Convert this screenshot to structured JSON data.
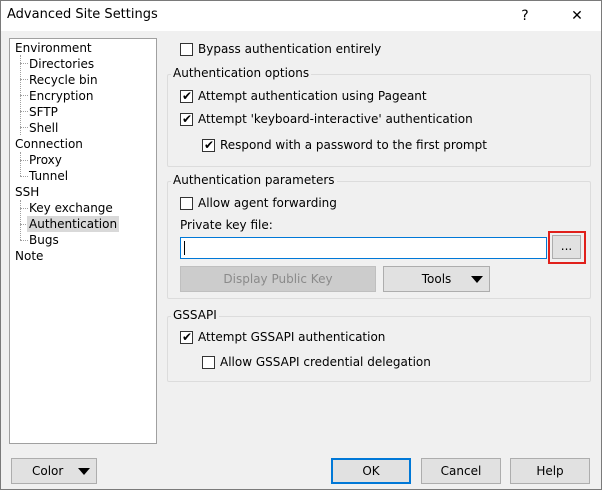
{
  "window": {
    "title": "Advanced Site Settings",
    "help_glyph": "?",
    "close_glyph": "✕"
  },
  "tree": {
    "items": [
      {
        "label": "Environment"
      },
      {
        "label": "Directories"
      },
      {
        "label": "Recycle bin"
      },
      {
        "label": "Encryption"
      },
      {
        "label": "SFTP"
      },
      {
        "label": "Shell"
      },
      {
        "label": "Connection"
      },
      {
        "label": "Proxy"
      },
      {
        "label": "Tunnel"
      },
      {
        "label": "SSH"
      },
      {
        "label": "Key exchange"
      },
      {
        "label": "Authentication"
      },
      {
        "label": "Bugs"
      },
      {
        "label": "Note"
      }
    ],
    "selected": "Authentication"
  },
  "bypass": {
    "label": "Bypass authentication entirely",
    "checked": false
  },
  "auth_options": {
    "title": "Authentication options",
    "pageant": {
      "label": "Attempt authentication using Pageant",
      "checked": true
    },
    "keyboard": {
      "label": "Attempt 'keyboard-interactive' authentication",
      "checked": true
    },
    "respond": {
      "label": "Respond with a password to the first prompt",
      "checked": true
    }
  },
  "auth_params": {
    "title": "Authentication parameters",
    "agent_forwarding": {
      "label": "Allow agent forwarding",
      "checked": false
    },
    "private_key_label": "Private key file:",
    "private_key_value": "",
    "browse_label": "...",
    "display_key_label": "Display Public Key",
    "tools_label": "Tools"
  },
  "gssapi": {
    "title": "GSSAPI",
    "attempt": {
      "label": "Attempt GSSAPI authentication",
      "checked": true
    },
    "delegation": {
      "label": "Allow GSSAPI credential delegation",
      "checked": false
    }
  },
  "footer": {
    "color_label": "Color",
    "ok_label": "OK",
    "cancel_label": "Cancel",
    "help_label": "Help"
  }
}
